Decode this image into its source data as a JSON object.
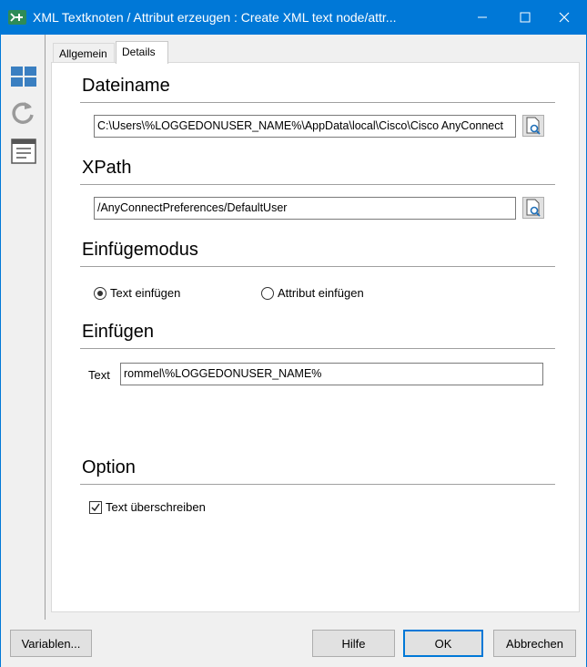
{
  "window": {
    "title": "XML Textknoten / Attribut erzeugen : Create XML text node/attr...",
    "accent_color": "#0078d7"
  },
  "tabs": [
    {
      "label": "Allgemein"
    },
    {
      "label": "Details"
    }
  ],
  "sections": {
    "dateiname": {
      "title": "Dateiname",
      "value": "C:\\Users\\%LOGGEDONUSER_NAME%\\AppData\\local\\Cisco\\Cisco AnyConnect"
    },
    "xpath": {
      "title": "XPath",
      "value": "/AnyConnectPreferences/DefaultUser"
    },
    "einfuegemodus": {
      "title": "Einfügemodus",
      "options": [
        {
          "label": "Text einfügen",
          "checked": true
        },
        {
          "label": "Attribut einfügen",
          "checked": false
        }
      ]
    },
    "einfuegen": {
      "title": "Einfügen",
      "text_label": "Text",
      "text_value": "rommel\\%LOGGEDONUSER_NAME%"
    },
    "option": {
      "title": "Option",
      "checkbox_label": "Text überschreiben",
      "checked": true
    }
  },
  "buttons": {
    "variables": "Variablen...",
    "help": "Hilfe",
    "ok": "OK",
    "cancel": "Abbrechen"
  }
}
